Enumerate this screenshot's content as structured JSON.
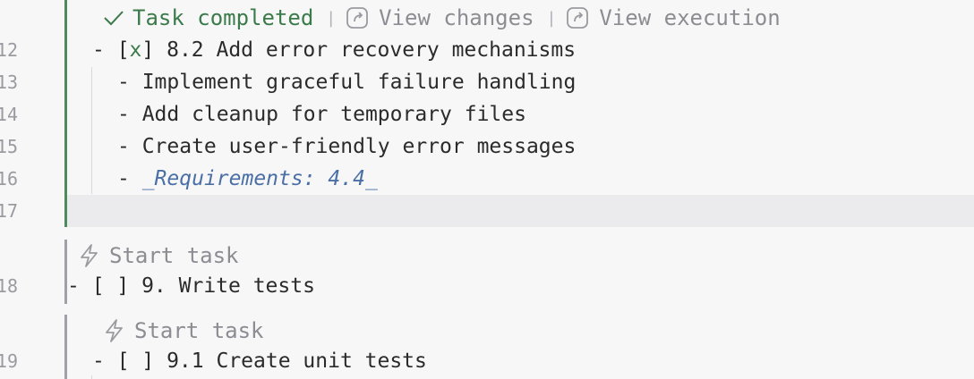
{
  "codelens_top": {
    "completed_label": "Task completed",
    "separator": "|",
    "view_changes_label": "View changes",
    "view_execution_label": "View execution"
  },
  "lines": [
    {
      "number": "12",
      "prefix": "- [",
      "check": "x",
      "suffix": "] 8.2 Add error recovery mechanisms"
    },
    {
      "number": "13",
      "text": "- Implement graceful failure handling"
    },
    {
      "number": "14",
      "text": "- Add cleanup for temporary files"
    },
    {
      "number": "15",
      "text": "- Create user-friendly error messages"
    },
    {
      "number": "16",
      "dash": "- ",
      "req": "_Requirements: 4.4_"
    },
    {
      "number": "17",
      "text": ""
    }
  ],
  "task9": {
    "start_label": "Start task",
    "line_number": "18",
    "text": "- [ ] 9. Write tests"
  },
  "task91": {
    "start_label": "Start task",
    "line_number": "19",
    "text": "- [ ] 9.1 Create unit tests"
  },
  "icons": [
    "check-icon",
    "open-external-icon",
    "lightning-icon"
  ],
  "colors": {
    "completed_green": "#3b7a4a",
    "gutter_green": "#4f8a5c",
    "gutter_gray": "#a0a0a6",
    "requirements_blue": "#4a6fa5",
    "cursor_line": "#ebebee"
  }
}
